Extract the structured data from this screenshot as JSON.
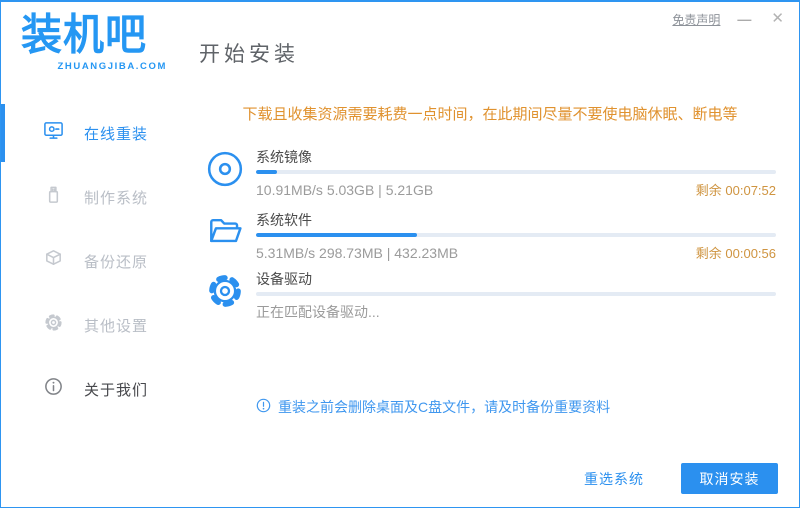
{
  "brand": {
    "logo_text": "装机吧",
    "logo_sub": "ZHUANGJIBA.COM",
    "color": "#2597f3"
  },
  "header": {
    "title": "开始安装",
    "disclaimer": "免责声明"
  },
  "window_controls": {
    "minimize": "—",
    "close": "✕"
  },
  "sidebar": {
    "items": [
      {
        "label": "在线重装",
        "icon": "monitor-icon",
        "active": true
      },
      {
        "label": "制作系统",
        "icon": "usb-icon",
        "active": false
      },
      {
        "label": "备份还原",
        "icon": "backup-cube-icon",
        "active": false
      },
      {
        "label": "其他设置",
        "icon": "gear-icon",
        "active": false
      },
      {
        "label": "关于我们",
        "icon": "info-icon",
        "active": false
      }
    ]
  },
  "main": {
    "warning": "下载且收集资源需要耗费一点时间，在此期间尽量不要使电脑休眠、断电等",
    "tasks": [
      {
        "name": "系统镜像",
        "icon": "disc-icon",
        "progress_percent": 4,
        "detail": "10.91MB/s 5.03GB | 5.21GB",
        "remaining": "剩余 00:07:52"
      },
      {
        "name": "系统软件",
        "icon": "folder-icon",
        "progress_percent": 31,
        "detail": "5.31MB/s 298.73MB | 432.23MB",
        "remaining": "剩余 00:00:56"
      },
      {
        "name": "设备驱动",
        "icon": "gear-icon",
        "progress_percent": 0,
        "detail": "正在匹配设备驱动...",
        "remaining": ""
      }
    ],
    "notice": "重装之前会删除桌面及C盘文件，请及时备份重要资料"
  },
  "footer": {
    "reselect_label": "重选系统",
    "cancel_label": "取消安装"
  },
  "colors": {
    "accent": "#2b90ef",
    "logo_blue": "#2597f3",
    "warning_orange": "#e0922f",
    "remaining_orange": "#cf9440",
    "progress_track": "#e4ebf4",
    "detail_gray": "#9b9b9b",
    "sidebar_inactive": "#b9bec6"
  }
}
